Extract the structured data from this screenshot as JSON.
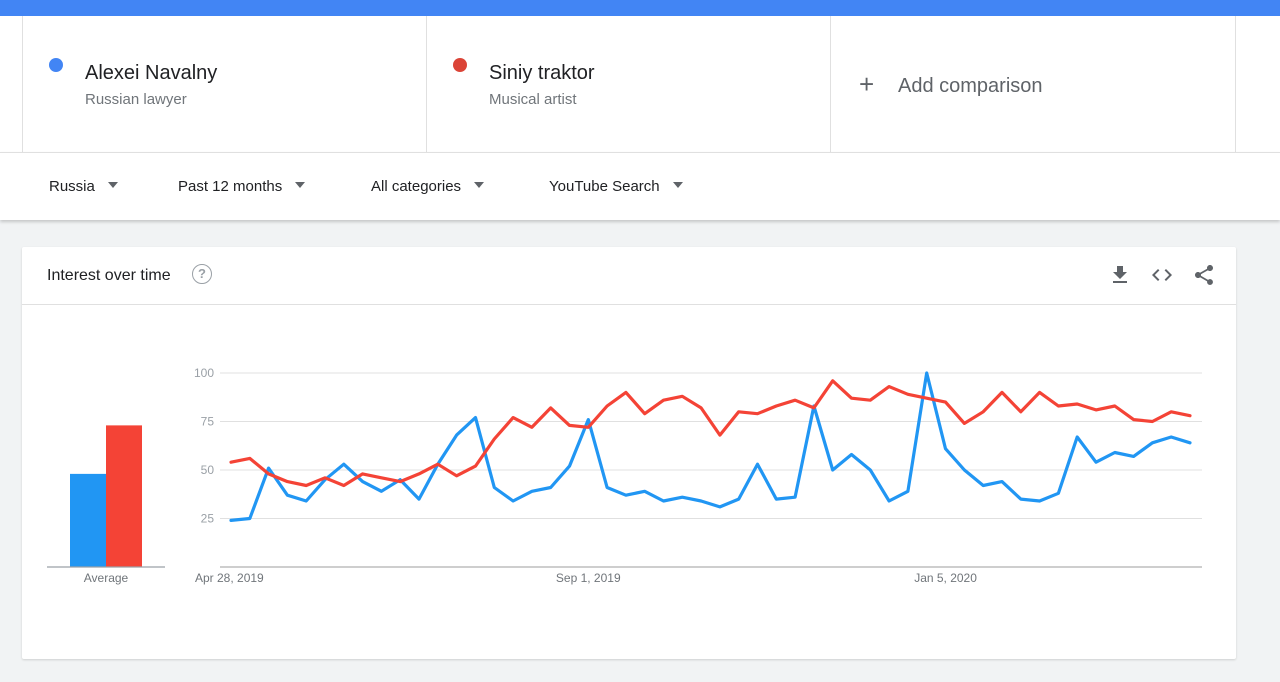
{
  "terms": [
    {
      "name": "Alexei Navalny",
      "subtitle": "Russian lawyer",
      "color": "#4285f4"
    },
    {
      "name": "Siniy traktor",
      "subtitle": "Musical artist",
      "color": "#db4437"
    }
  ],
  "add_comparison": {
    "label": "Add comparison",
    "icon": "plus-icon"
  },
  "filters": {
    "region": "Russia",
    "period": "Past 12 months",
    "category": "All categories",
    "source": "YouTube Search"
  },
  "card": {
    "title": "Interest over time",
    "icons": [
      "help-icon",
      "download-icon",
      "embed-icon",
      "share-icon"
    ]
  },
  "chart_data": {
    "type": "line",
    "x_labels": [
      "Apr 28, 2019",
      "Sep 1, 2019",
      "Jan 5, 2020"
    ],
    "ylim": [
      0,
      100
    ],
    "y_ticks": [
      25,
      50,
      75,
      100
    ],
    "grid": true,
    "average_label": "Average",
    "series": [
      {
        "name": "Alexei Navalny",
        "color": "#2196f3",
        "average": 48,
        "values": [
          24,
          25,
          51,
          37,
          34,
          45,
          53,
          44,
          39,
          45,
          35,
          53,
          68,
          77,
          41,
          34,
          39,
          41,
          52,
          76,
          41,
          37,
          39,
          34,
          36,
          34,
          31,
          35,
          53,
          35,
          36,
          83,
          50,
          58,
          50,
          34,
          39,
          100,
          61,
          50,
          42,
          44,
          35,
          34,
          38,
          67,
          54,
          59,
          57,
          64,
          67,
          64
        ]
      },
      {
        "name": "Siniy traktor",
        "color": "#f44336",
        "average": 73,
        "values": [
          54,
          56,
          48,
          44,
          42,
          46,
          42,
          48,
          46,
          44,
          48,
          53,
          47,
          52,
          66,
          77,
          72,
          82,
          73,
          72,
          83,
          90,
          79,
          86,
          88,
          82,
          68,
          80,
          79,
          83,
          86,
          82,
          96,
          87,
          86,
          93,
          89,
          87,
          85,
          74,
          80,
          90,
          80,
          90,
          83,
          84,
          81,
          83,
          76,
          75,
          80,
          78
        ]
      }
    ]
  }
}
